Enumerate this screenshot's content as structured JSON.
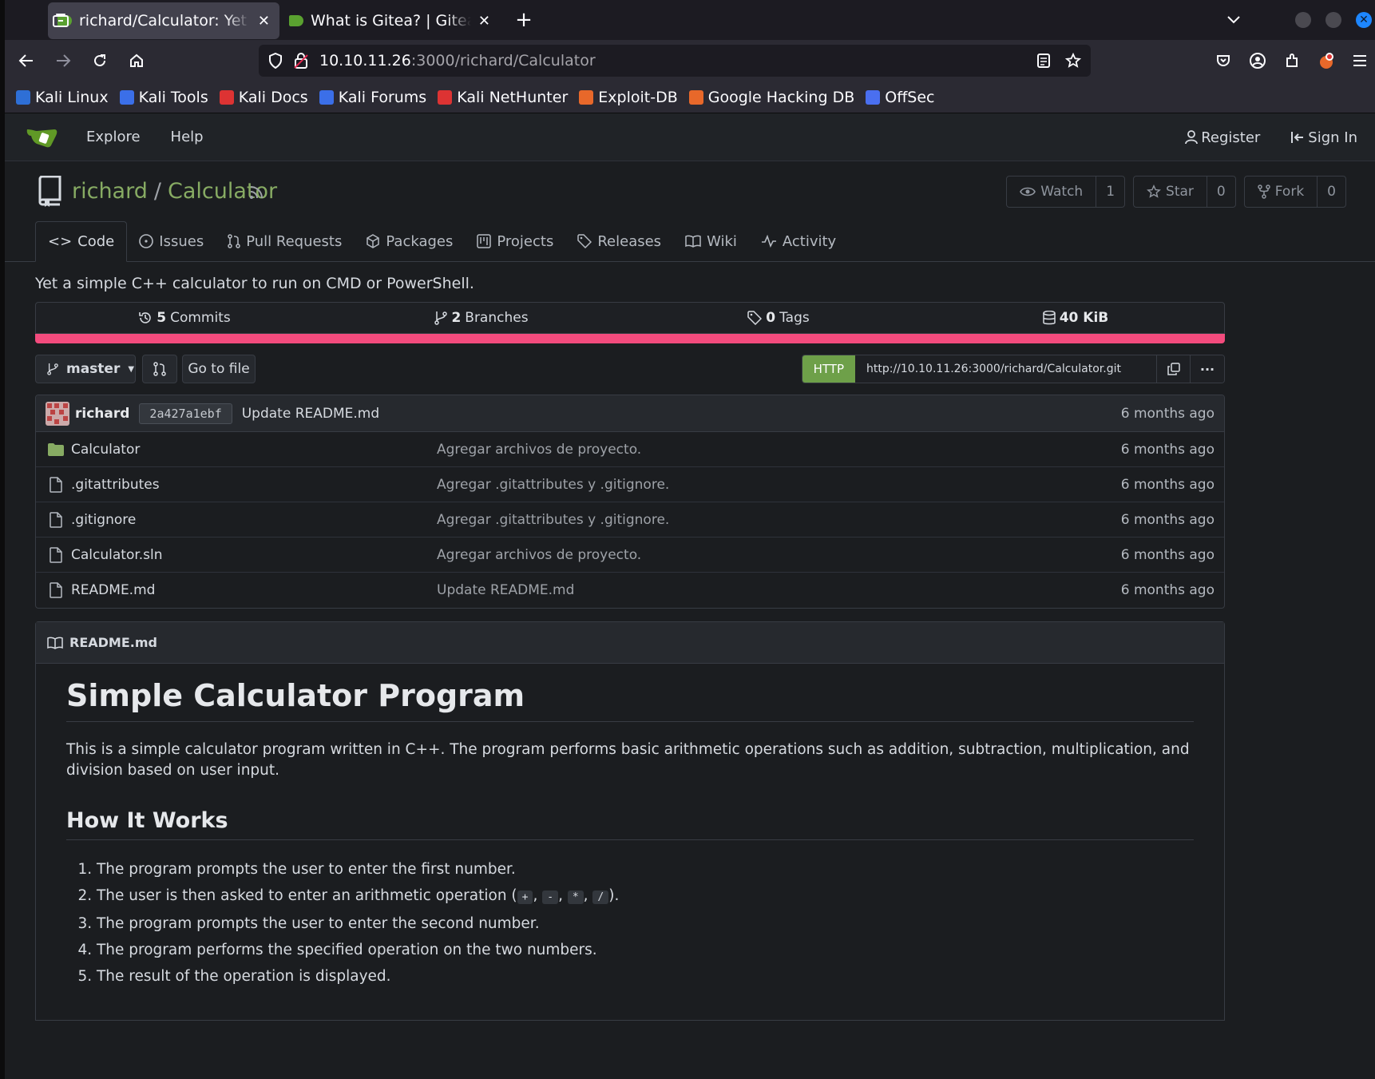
{
  "browser": {
    "tabs": [
      {
        "title": "richard/Calculator: Yet a simple C++ calculator",
        "active": true
      },
      {
        "title": "What is Gitea? | Gitea Documentation",
        "active": false
      }
    ],
    "new_tab": "+",
    "url_host": "10.10.11.26",
    "url_path": ":3000/richard/Calculator",
    "bookmarks": [
      {
        "label": "Kali Linux",
        "color": "#2e6fd6"
      },
      {
        "label": "Kali Tools",
        "color": "#3b6fe8"
      },
      {
        "label": "Kali Docs",
        "color": "#d33"
      },
      {
        "label": "Kali Forums",
        "color": "#3b6fe8"
      },
      {
        "label": "Kali NetHunter",
        "color": "#d33"
      },
      {
        "label": "Exploit-DB",
        "color": "#e8682a"
      },
      {
        "label": "Google Hacking DB",
        "color": "#e8682a"
      },
      {
        "label": "OffSec",
        "color": "#4a6ff0"
      }
    ]
  },
  "gitea": {
    "nav": {
      "explore": "Explore",
      "help": "Help",
      "register": "Register",
      "signin": "Sign In"
    },
    "repo": {
      "owner": "richard",
      "sep": "/",
      "name": "Calculator",
      "watch_label": "Watch",
      "watch_count": "1",
      "star_label": "Star",
      "star_count": "0",
      "fork_label": "Fork",
      "fork_count": "0",
      "tabs": [
        "Code",
        "Issues",
        "Pull Requests",
        "Packages",
        "Projects",
        "Releases",
        "Wiki",
        "Activity"
      ],
      "description": "Yet a simple C++ calculator to run on CMD or PowerShell."
    },
    "stats": {
      "commits_n": "5",
      "commits_label": "Commits",
      "branches_n": "2",
      "branches_label": "Branches",
      "tags_n": "0",
      "tags_label": "Tags",
      "size_n": "40 KiB"
    },
    "language_color": "#f34b7d",
    "toolbar": {
      "branch": "master",
      "goto": "Go to file",
      "protocol": "HTTP",
      "clone_url": "http://10.10.11.26:3000/richard/Calculator.git",
      "more": "···"
    },
    "last_commit": {
      "user": "richard",
      "sha": "2a427a1ebf",
      "message": "Update README.md",
      "age": "6 months ago"
    },
    "files": [
      {
        "name": "Calculator",
        "type": "folder",
        "message": "Agregar archivos de proyecto.",
        "age": "6 months ago"
      },
      {
        "name": ".gitattributes",
        "type": "file",
        "message": "Agregar .gitattributes y .gitignore.",
        "age": "6 months ago"
      },
      {
        "name": ".gitignore",
        "type": "file",
        "message": "Agregar .gitattributes y .gitignore.",
        "age": "6 months ago"
      },
      {
        "name": "Calculator.sln",
        "type": "file",
        "message": "Agregar archivos de proyecto.",
        "age": "6 months ago"
      },
      {
        "name": "README.md",
        "type": "file",
        "message": "Update README.md",
        "age": "6 months ago"
      }
    ],
    "readme": {
      "filename": "README.md",
      "h1": "Simple Calculator Program",
      "intro": "This is a simple calculator program written in C++. The program performs basic arithmetic operations such as addition, subtraction, multiplication, and division based on user input.",
      "h2": "How It Works",
      "steps": [
        "The program prompts the user to enter the first number.",
        "The user is then asked to enter an arithmetic operation (",
        "The program prompts the user to enter the second number.",
        "The program performs the specified operation on the two numbers.",
        "The result of the operation is displayed."
      ],
      "ops": [
        "+",
        "-",
        "*",
        "/"
      ],
      "op_sep": ", ",
      "step2_end": ")."
    }
  }
}
